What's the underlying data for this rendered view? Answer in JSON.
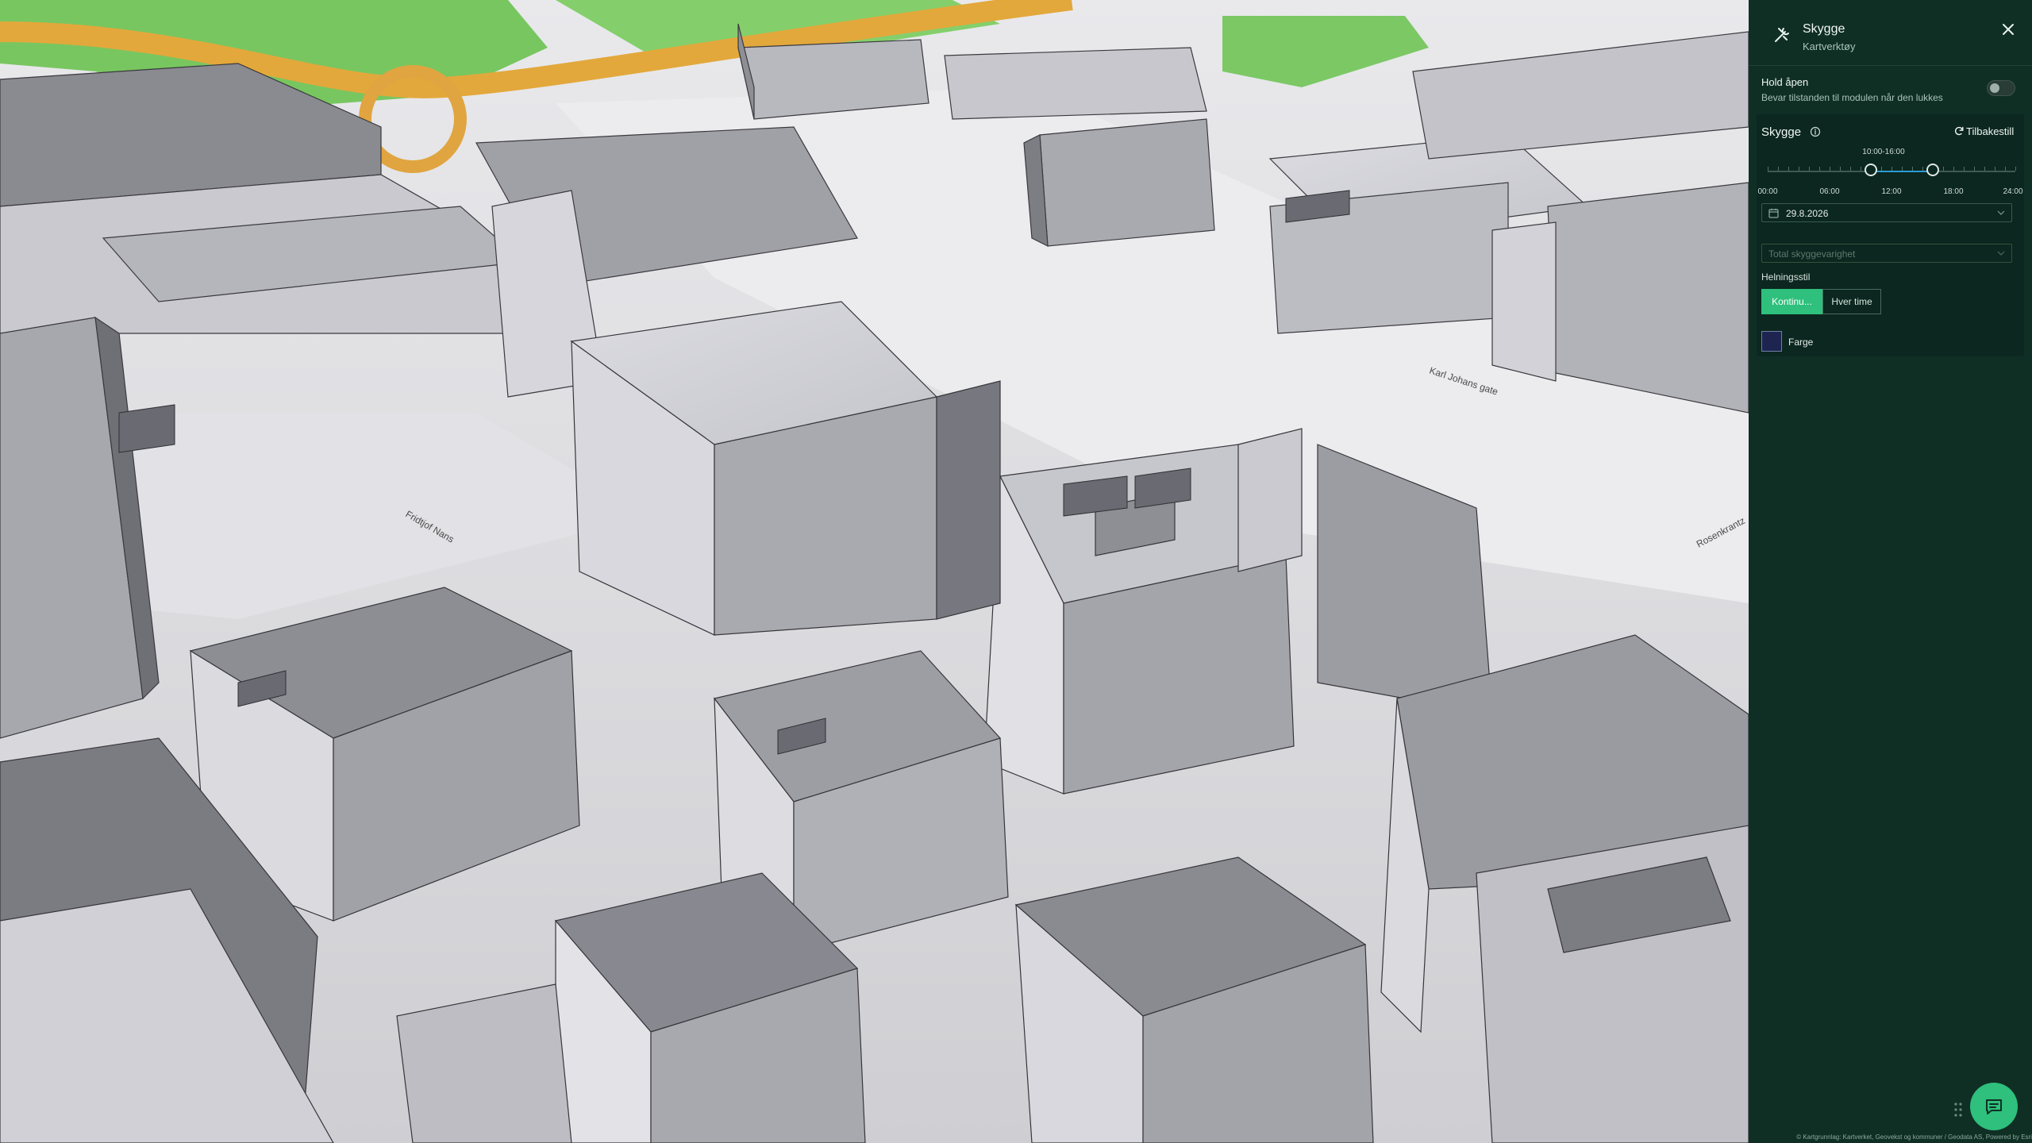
{
  "map": {
    "street_labels": [
      "Karl Johans gate",
      "Fridtjof Nans",
      "Rosenkrantz"
    ]
  },
  "panel": {
    "title": "Skygge",
    "subtitle": "Kartverktøy",
    "icons": {
      "tool": "tools-icon",
      "close": "close-icon"
    },
    "hold_open": {
      "title": "Hold åpen",
      "description": "Bevar tilstanden til modulen når den lukkes",
      "enabled": false
    },
    "shadow": {
      "title": "Skygge",
      "reset_label": "Tilbakestill",
      "range_label": "10:00-16:00",
      "range_start_fraction": 0.4167,
      "range_end_fraction": 0.6667,
      "ticks": [
        "00:00",
        "06:00",
        "12:00",
        "18:00",
        "24:00"
      ],
      "date": "29.8.2026",
      "duration_placeholder": "Total skyggevarighet",
      "style_label": "Helningsstil",
      "style_options": [
        "Kontinu...",
        "Hver time"
      ],
      "selected_style": "Kontinu...",
      "color_label": "Farge",
      "color_value": "#1d2450"
    },
    "accent_color": "#2ec07c",
    "panel_color": "#0f2f25"
  },
  "footer": {
    "attribution": "© Kartgrunnlag: Kartverket, Geovekst og kommuner / Geodata AS, Powered by Esri"
  },
  "chat": {
    "icon": "chat-icon"
  }
}
